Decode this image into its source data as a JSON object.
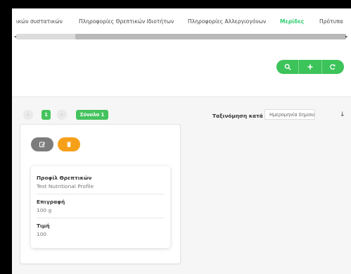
{
  "tabs": [
    {
      "label": "ικών συστατικών"
    },
    {
      "label": "Πληροφορίες Θρεπτικών Ιδιοτήτων"
    },
    {
      "label": "Πληροφορίες Αλλεργιογόνων"
    },
    {
      "label": "Μερίδες"
    },
    {
      "label": "Πρότυπα"
    }
  ],
  "active_tab": "Μερίδες",
  "scroll": {
    "left": "◂",
    "right": "▸"
  },
  "toolbar": {
    "icons": [
      "search-icon",
      "plus-icon",
      "refresh-icon"
    ]
  },
  "pagination": {
    "prev": "‹",
    "current": "1",
    "next": "›",
    "total": "Σύνολο 1"
  },
  "sort": {
    "label": "Ταξινόμηση κατά",
    "selected": "Ημερομηνία δημιουργ",
    "chevron": "∨",
    "direction": "↓"
  },
  "card": {
    "actions": [
      "edit-icon",
      "delete-icon"
    ],
    "fields": [
      {
        "label": "Προφίλ Θρεπτικών",
        "value": "Test Nutritional Profile"
      },
      {
        "label": "Επιγραφή",
        "value": "100 g"
      },
      {
        "label": "Τιμή",
        "value": "100"
      }
    ]
  },
  "colors": {
    "accent": "#45c35e",
    "delete": "#f6a01a",
    "edit": "#7c7c7c"
  }
}
